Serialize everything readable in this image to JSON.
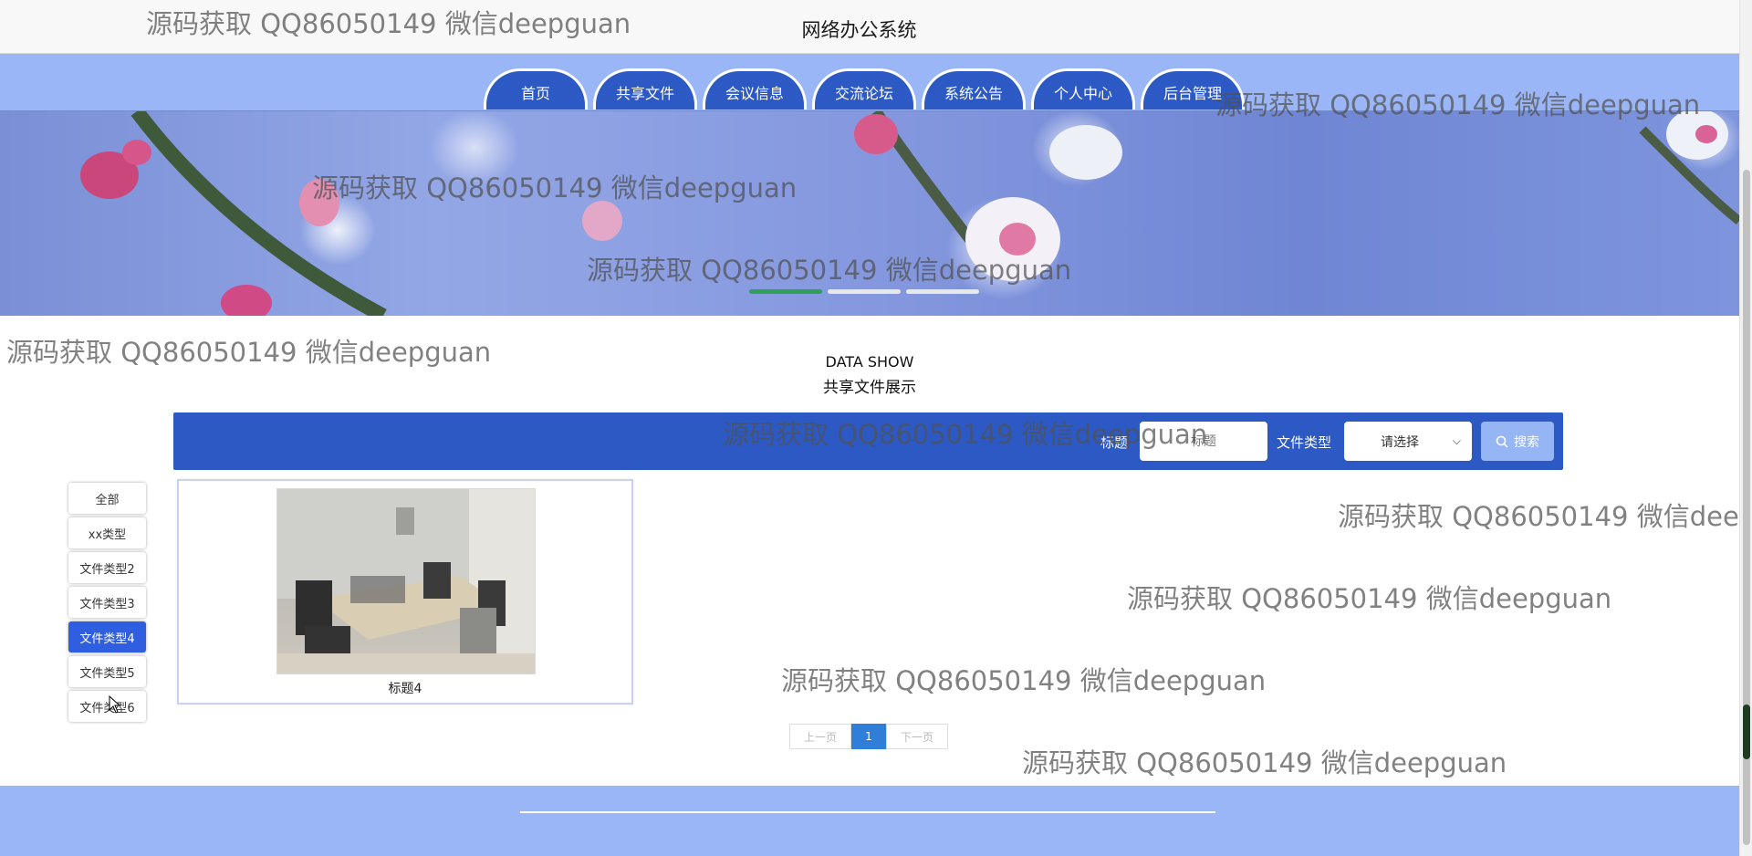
{
  "header": {
    "title": "网络办公系统"
  },
  "nav": {
    "items": [
      {
        "label": "首页"
      },
      {
        "label": "共享文件"
      },
      {
        "label": "会议信息"
      },
      {
        "label": "交流论坛"
      },
      {
        "label": "系统公告"
      },
      {
        "label": "个人中心"
      },
      {
        "label": "后台管理"
      }
    ]
  },
  "banner": {
    "slide_count": 3,
    "active_slide": 1
  },
  "section": {
    "title_en": "DATA SHOW",
    "title_cn": "共享文件展示"
  },
  "search": {
    "title_label": "标题",
    "title_placeholder": "标题",
    "type_label": "文件类型",
    "type_select_value": "请选择",
    "button_label": "搜索"
  },
  "categories": [
    {
      "label": "全部",
      "active": false
    },
    {
      "label": "xx类型",
      "active": false
    },
    {
      "label": "文件类型2",
      "active": false
    },
    {
      "label": "文件类型3",
      "active": false
    },
    {
      "label": "文件类型4",
      "active": true
    },
    {
      "label": "文件类型5",
      "active": false
    },
    {
      "label": "文件类型6",
      "active": false
    }
  ],
  "cards": [
    {
      "title": "标题4",
      "image": "office-desk-photo"
    }
  ],
  "pagination": {
    "prev_label": "上一页",
    "current_page": "1",
    "next_label": "下一页"
  },
  "watermark": {
    "text": "源码获取 QQ86050149 微信deepguan"
  },
  "colors": {
    "nav_band": "#9ab6f7",
    "primary": "#2c59c4",
    "active_category": "#2f5fe0",
    "search_button": "#96b5f5",
    "pager_active": "#2f7fd8",
    "slide_active": "#2f9f5a"
  }
}
